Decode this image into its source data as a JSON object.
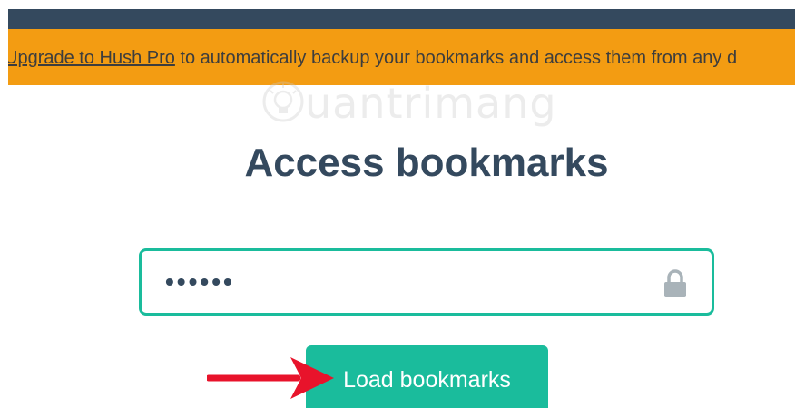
{
  "banner": {
    "link_text": "Upgrade to Hush Pro",
    "message": " to automatically backup your bookmarks and access them from any d"
  },
  "watermark": {
    "text": "uantrimang"
  },
  "main": {
    "title": "Access bookmarks",
    "password_value": "••••••",
    "load_button_label": "Load bookmarks"
  },
  "icons": {
    "lock": "lock-icon",
    "arrow": "arrow-icon",
    "watermark_logo": "lightbulb-icon"
  },
  "colors": {
    "topbar": "#34495e",
    "banner": "#f39c12",
    "accent": "#1abc9c",
    "title": "#34495e",
    "arrow": "#e8132b"
  }
}
